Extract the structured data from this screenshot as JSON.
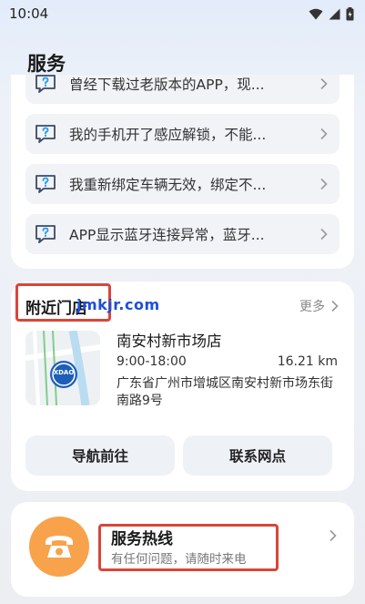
{
  "status": {
    "time": "10:04"
  },
  "page": {
    "title": "服务"
  },
  "faq": {
    "items": [
      {
        "text": "曾经下载过老版本的APP，现..."
      },
      {
        "text": "我的手机开了感应解锁，不能..."
      },
      {
        "text": "我重新绑定车辆无效，绑定不..."
      },
      {
        "text": "APP显示蓝牙连接异常，蓝牙..."
      }
    ]
  },
  "nearby": {
    "title": "附近门店",
    "more_label": "更多",
    "watermark": "jmkjr.com",
    "store": {
      "name": "南安村新市场店",
      "hours": "9:00-18:00",
      "distance": "16.21 km",
      "address": "广东省广州市增城区南安村新市场东街南路9号",
      "map_badge": "XDAO"
    },
    "navigate_label": "导航前往",
    "contact_label": "联系网点"
  },
  "hotline": {
    "title": "服务热线",
    "subtitle": "有任何问题，请随时来电"
  },
  "colors": {
    "accent_orange": "#f8a24c",
    "highlight_red": "#d9453a",
    "watermark_blue": "#1d4fd8"
  },
  "icons": [
    "wifi-icon",
    "signal-icon",
    "battery-icon",
    "question-bubble-icon",
    "chevron-right-icon",
    "phone-icon"
  ]
}
